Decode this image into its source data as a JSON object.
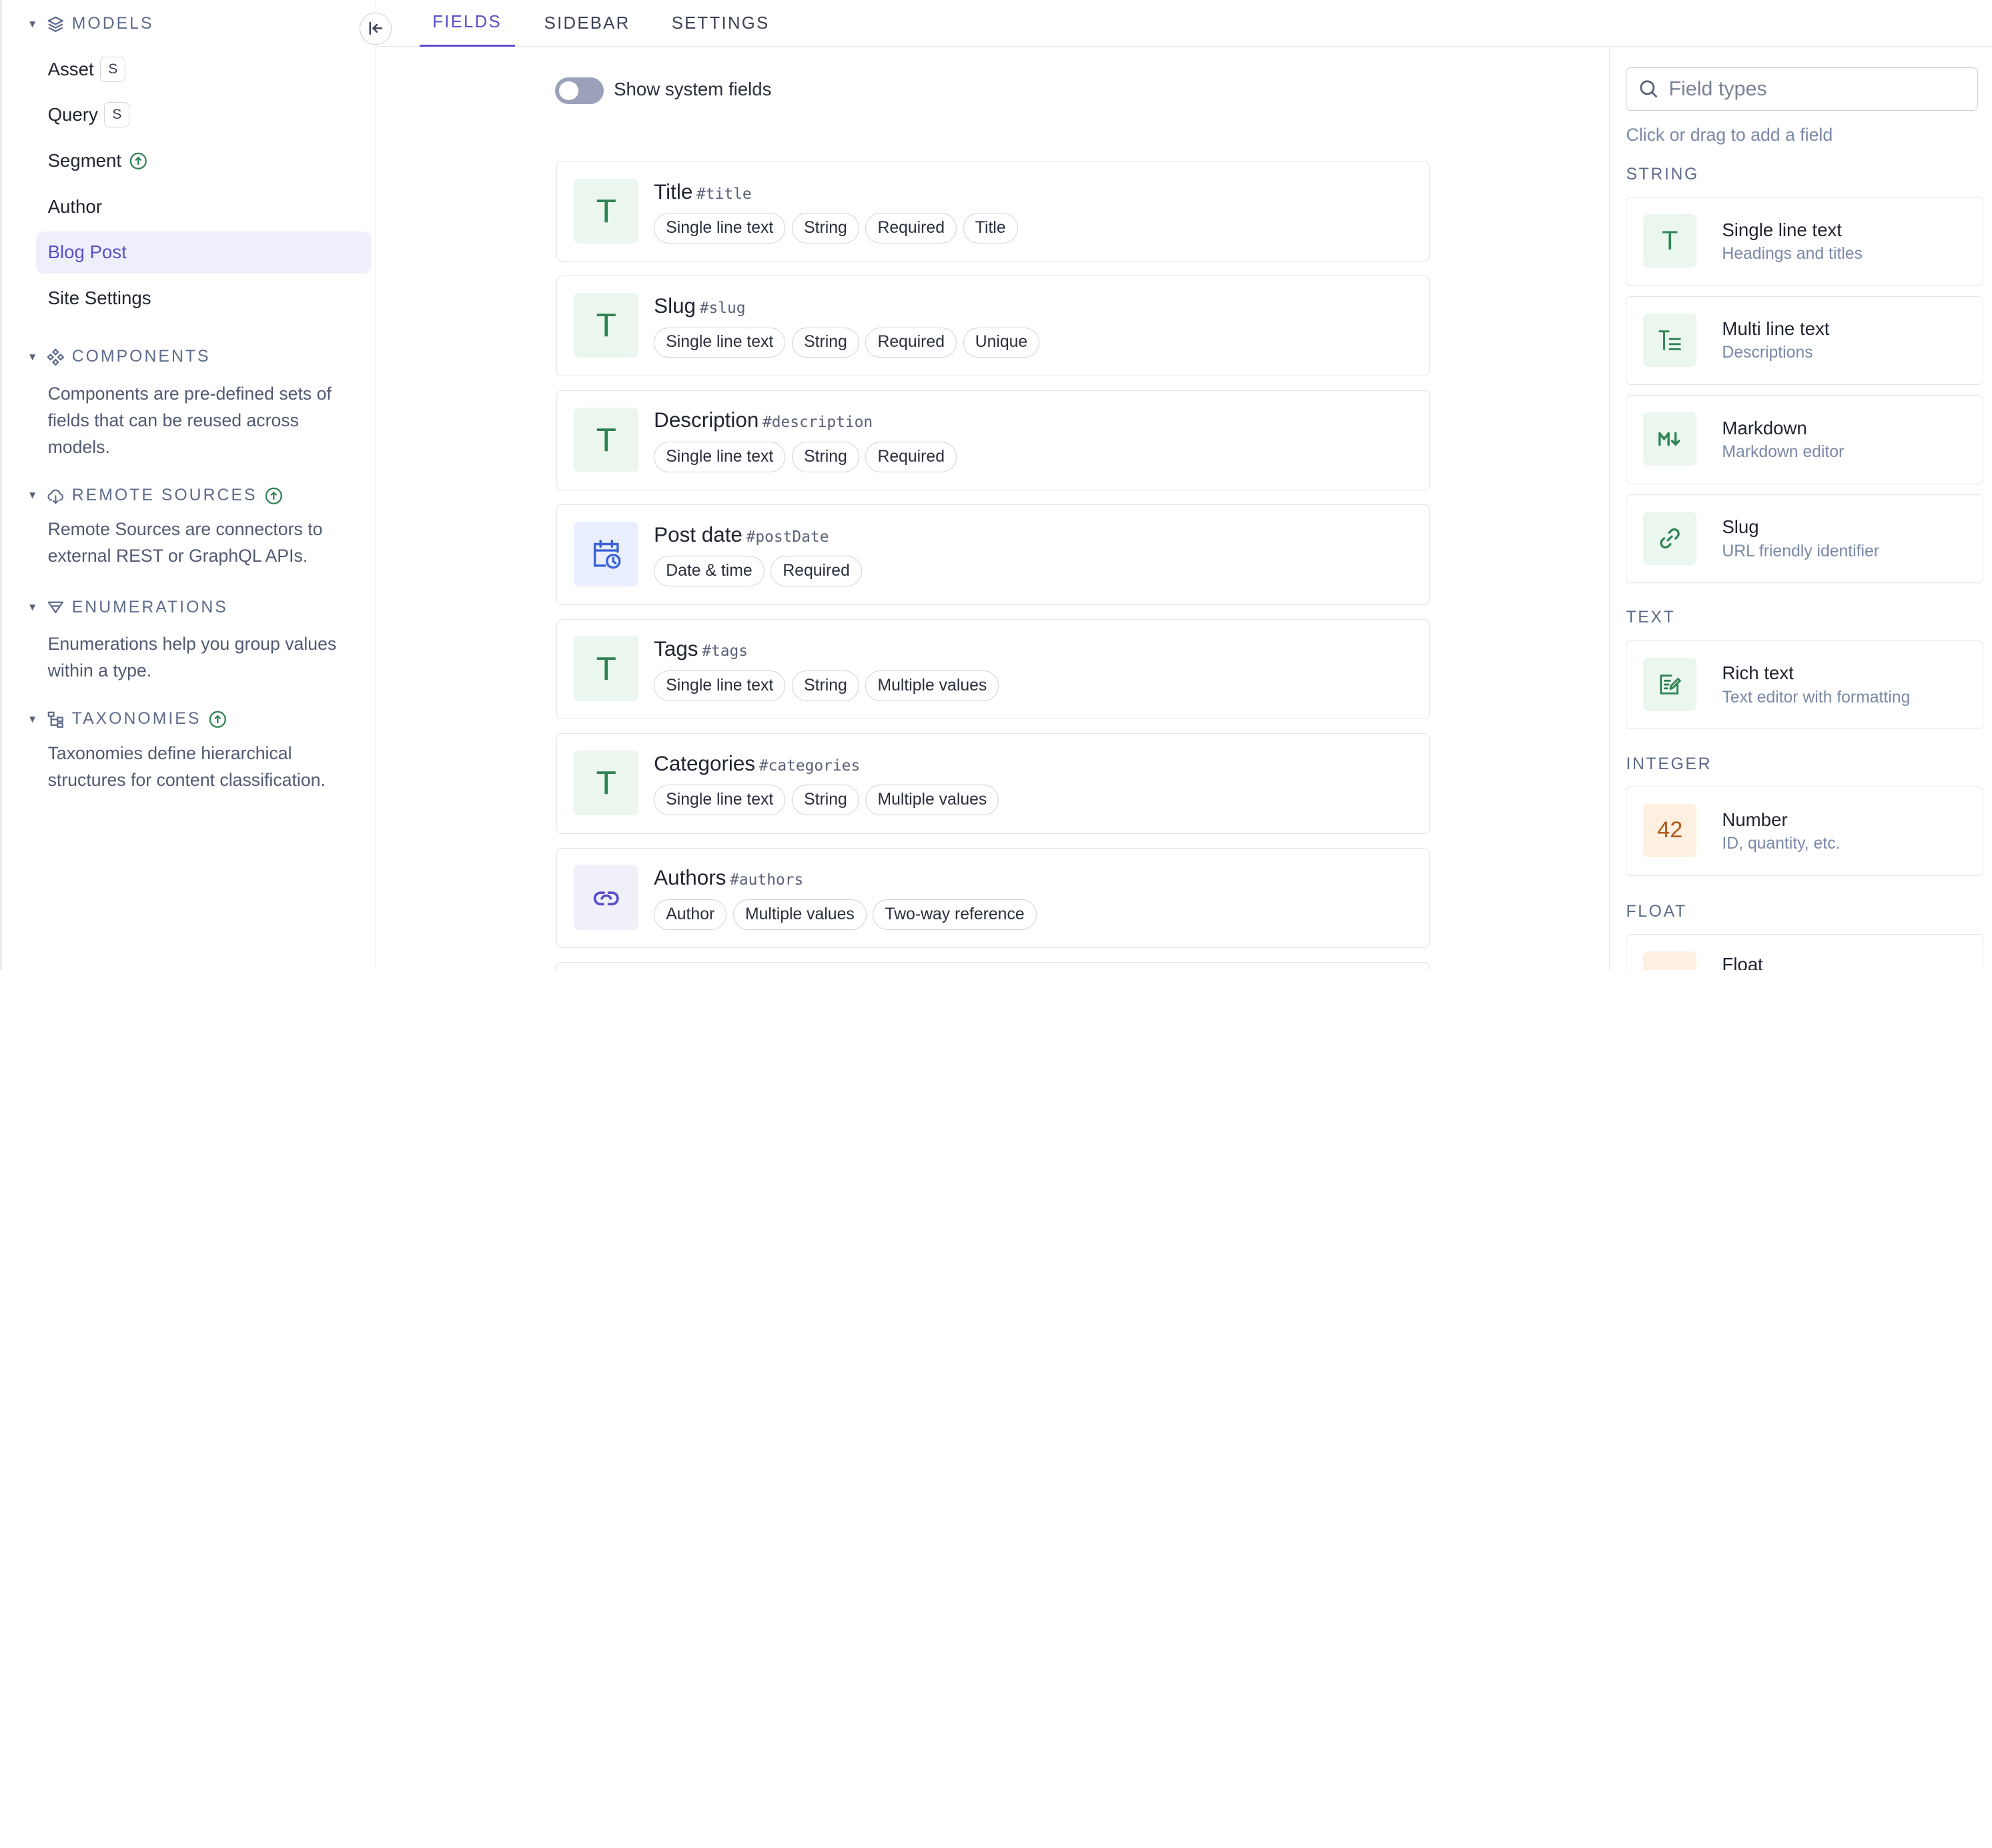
{
  "sidebar": {
    "models": {
      "title": "MODELS",
      "items": [
        {
          "label": "Asset",
          "badge": "S"
        },
        {
          "label": "Query",
          "badge": "S"
        },
        {
          "label": "Segment"
        },
        {
          "label": "Author"
        },
        {
          "label": "Blog Post",
          "active": true
        },
        {
          "label": "Site Settings"
        }
      ]
    },
    "components": {
      "title": "COMPONENTS",
      "description": "Components are pre-defined sets of fields that can be reused across models."
    },
    "remote_sources": {
      "title": "REMOTE SOURCES",
      "description": "Remote Sources are connectors to external REST or GraphQL APIs."
    },
    "enumerations": {
      "title": "ENUMERATIONS",
      "description": "Enumerations help you group values within a type."
    },
    "taxonomies": {
      "title": "TAXONOMIES",
      "description": "Taxonomies define hierarchical structures for content classification."
    }
  },
  "tabs": [
    {
      "label": "FIELDS",
      "active": true
    },
    {
      "label": "SIDEBAR"
    },
    {
      "label": "SETTINGS"
    }
  ],
  "main": {
    "toggle_label": "Show system fields",
    "toggle_on": false,
    "fields": [
      {
        "name": "Title",
        "api": "#title",
        "icon": "text-t-icon",
        "tags": [
          "Single line text",
          "String",
          "Required",
          "Title"
        ]
      },
      {
        "name": "Slug",
        "api": "#slug",
        "icon": "text-t-icon",
        "tags": [
          "Single line text",
          "String",
          "Required",
          "Unique"
        ]
      },
      {
        "name": "Description",
        "api": "#description",
        "icon": "text-t-icon",
        "tags": [
          "Single line text",
          "String",
          "Required"
        ]
      },
      {
        "name": "Post date",
        "api": "#postDate",
        "icon": "calendar-clock-icon",
        "tags": [
          "Date & time",
          "Required"
        ]
      },
      {
        "name": "Tags",
        "api": "#tags",
        "icon": "text-t-icon",
        "tags": [
          "Single line text",
          "String",
          "Multiple values"
        ]
      },
      {
        "name": "Categories",
        "api": "#categories",
        "icon": "text-t-icon",
        "tags": [
          "Single line text",
          "String",
          "Multiple values"
        ]
      },
      {
        "name": "Authors",
        "api": "#authors",
        "icon": "reference-link-icon",
        "tags": [
          "Author",
          "Multiple values",
          "Two-way reference"
        ]
      }
    ]
  },
  "right_panel": {
    "search_placeholder": "Field types",
    "hint": "Click or drag to add a field",
    "groups": {
      "string": "STRING",
      "text": "TEXT",
      "integer": "INTEGER",
      "float": "FLOAT"
    },
    "types": {
      "single_line": {
        "name": "Single line text",
        "desc": "Headings and titles",
        "glyph": "T"
      },
      "multi_line": {
        "name": "Multi line text",
        "desc": "Descriptions"
      },
      "markdown": {
        "name": "Markdown",
        "desc": "Markdown editor"
      },
      "slug": {
        "name": "Slug",
        "desc": "URL friendly identifier"
      },
      "rich_text": {
        "name": "Rich text",
        "desc": "Text editor with formatting"
      },
      "number": {
        "name": "Number",
        "desc": "ID, quantity, etc.",
        "glyph": "42"
      },
      "float": {
        "name": "Float"
      }
    }
  },
  "colors": {
    "accent": "#5b4fc9",
    "green": "#2f8253",
    "blue": "#3b63d6"
  }
}
